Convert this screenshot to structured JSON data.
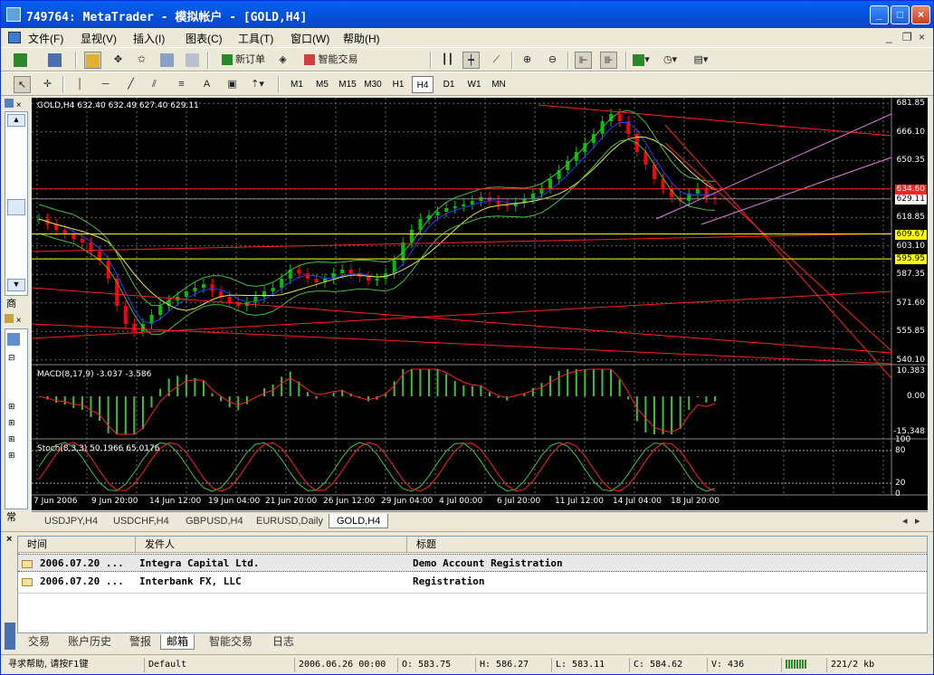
{
  "window": {
    "title": "749764: MetaTrader - 模拟帐户 - [GOLD,H4]",
    "minimize": "_",
    "maximize": "□",
    "close": "×"
  },
  "menu": [
    "文件(F)",
    "显视(V)",
    "插入(I)",
    "图表(C)",
    "工具(T)",
    "窗口(W)",
    "帮助(H)"
  ],
  "mdi": {
    "minimize": "_",
    "restore": "❐",
    "close": "×"
  },
  "toolbar1": {
    "new_order": "新订单",
    "expert": "智能交易"
  },
  "toolbar2": {
    "text_tool": "A",
    "timeframes": [
      "M1",
      "M5",
      "M15",
      "M30",
      "H1",
      "H4",
      "D1",
      "W1",
      "MN"
    ],
    "selected_timeframe": "H4"
  },
  "chart": {
    "header": "GOLD,H4  632.40 632.49 627.40 629.11",
    "price_labels": [
      "681.85",
      "666.10",
      "650.35",
      "634.60",
      "629.11",
      "618.85",
      "609.67",
      "603.10",
      "595.95",
      "587.35",
      "571.60",
      "555.85",
      "540.10"
    ],
    "macd_label": "MACD(8,17,9) -3.037 -3.586",
    "macd_scale": [
      "10.383",
      "0.00",
      "-15.348"
    ],
    "stoch_label": "Stoch(8,3,3) 50.1966 65.0176",
    "stoch_scale": [
      "100",
      "80",
      "20",
      "0"
    ],
    "time_labels": [
      "7 Jun 2006",
      "9 Jun 20:00",
      "14 Jun 12:00",
      "19 Jun 04:00",
      "21 Jun 20:00",
      "26 Jun 12:00",
      "29 Jun 04:00",
      "4 Jul 00:00",
      "6 Jul 20:00",
      "11 Jul 12:00",
      "14 Jul 04:00",
      "18 Jul 20:00"
    ],
    "colors": {
      "bull": "#00c000",
      "bear": "#ff0000",
      "grid": "#6a6a6a",
      "price_line": "#ffffff"
    }
  },
  "chart_tabs": [
    "USDJPY,H4",
    "USDCHF,H4",
    "GBPUSD,H4",
    "EURUSD,Daily",
    "GOLD,H4"
  ],
  "chart_tabs_active": 4,
  "terminal": {
    "columns": [
      "时间",
      "发件人",
      "标题"
    ],
    "rows": [
      {
        "time": "2006.07.20 ...",
        "from": "Integra Capital Ltd.",
        "subject": "Demo Account Registration"
      },
      {
        "time": "2006.07.20 ...",
        "from": "Interbank FX, LLC",
        "subject": "Registration"
      }
    ],
    "tabs": [
      "交易",
      "账户历史",
      "警报",
      "邮箱",
      "智能交易",
      "日志"
    ],
    "active_tab": 3
  },
  "left_panel": {
    "tab1": "商",
    "tab2": "常"
  },
  "status": {
    "help": "寻求帮助, 请按F1键",
    "profile": "Default",
    "datetime": "2006.06.26 00:00",
    "open": "O: 583.75",
    "high": "H: 586.27",
    "low": "L: 583.11",
    "close": "C: 584.62",
    "volume": "V: 436",
    "traffic": "221/2 kb"
  }
}
